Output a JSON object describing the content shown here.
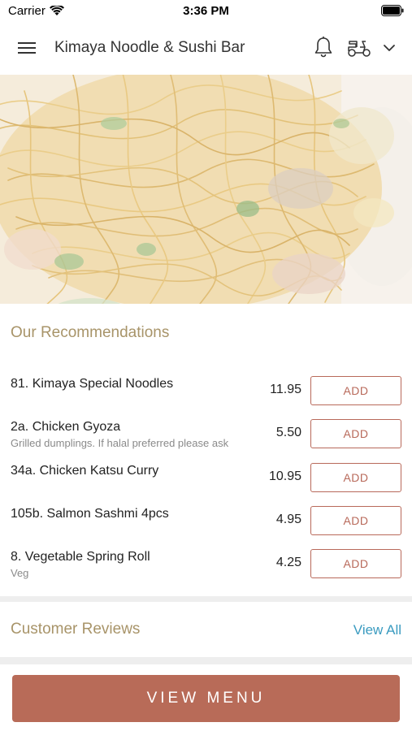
{
  "status_bar": {
    "carrier": "Carrier",
    "time": "3:36 PM"
  },
  "header": {
    "title": "Kimaya Noodle & Sushi Bar",
    "icons": [
      "hamburger-menu-icon",
      "bell-icon",
      "delivery-scooter-icon",
      "chevron-down-icon"
    ]
  },
  "recommendations": {
    "heading": "Our Recommendations",
    "add_label": "ADD",
    "items": [
      {
        "name": "81. Kimaya Special Noodles",
        "description": "",
        "price": "11.95"
      },
      {
        "name": "2a. Chicken Gyoza",
        "description": "Grilled dumplings. If halal preferred please ask",
        "price": "5.50"
      },
      {
        "name": "34a. Chicken Katsu Curry",
        "description": "",
        "price": "10.95"
      },
      {
        "name": "105b. Salmon Sashmi 4pcs",
        "description": "",
        "price": "4.95"
      },
      {
        "name": "8. Vegetable Spring Roll",
        "description": "Veg",
        "price": "4.25"
      }
    ]
  },
  "reviews": {
    "heading": "Customer Reviews",
    "view_all": "View All"
  },
  "footer": {
    "view_menu": "VIEW MENU"
  },
  "colors": {
    "accent": "#b86b58",
    "heading_gold": "#a89469",
    "link_blue": "#3a9bc0"
  }
}
